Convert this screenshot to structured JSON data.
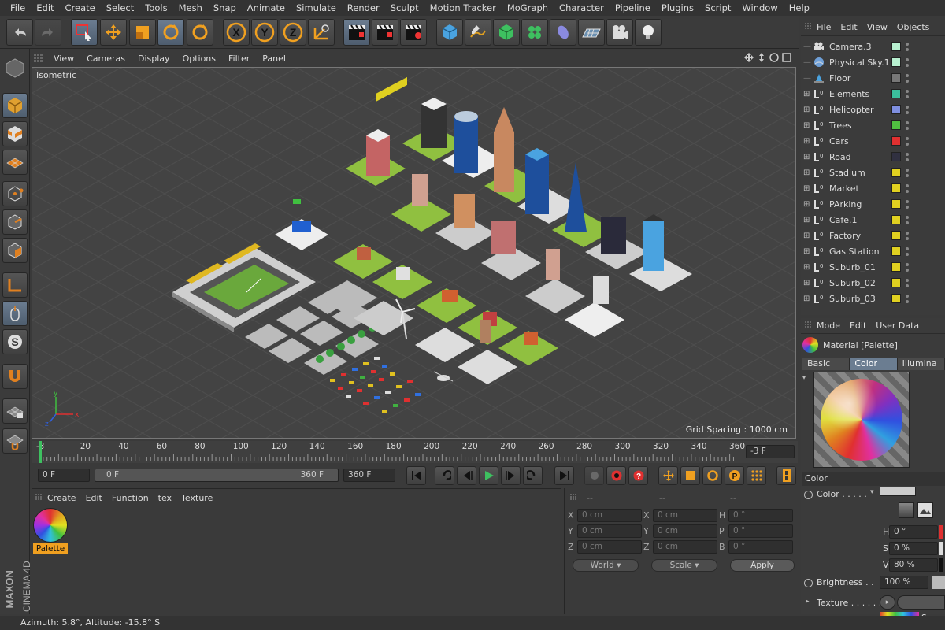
{
  "menubar": [
    "File",
    "Edit",
    "Create",
    "Select",
    "Tools",
    "Mesh",
    "Snap",
    "Animate",
    "Simulate",
    "Render",
    "Sculpt",
    "Motion Tracker",
    "MoGraph",
    "Character",
    "Pipeline",
    "Plugins",
    "Script",
    "Window",
    "Help"
  ],
  "viewport": {
    "menu": [
      "View",
      "Cameras",
      "Display",
      "Options",
      "Filter",
      "Panel"
    ],
    "title": "Isometric",
    "grid_spacing": "Grid Spacing : 1000 cm"
  },
  "timeline": {
    "ticks": [
      "-3",
      "20",
      "40",
      "60",
      "80",
      "100",
      "120",
      "140",
      "160",
      "180",
      "200",
      "220",
      "240",
      "260",
      "280",
      "300",
      "320",
      "340",
      "360"
    ],
    "current_frame": "-3 F"
  },
  "transport": {
    "start": "0 F",
    "slider_left": "0 F",
    "slider_right": "360 F",
    "end": "360 F"
  },
  "material_manager": {
    "menu": [
      "Create",
      "Edit",
      "Function",
      "tex",
      "Texture"
    ],
    "material_name": "Palette"
  },
  "coordinates": {
    "headers": [
      "--",
      "--",
      "--"
    ],
    "rows": [
      {
        "a": "X",
        "av": "0 cm",
        "b": "X",
        "bv": "0 cm",
        "c": "H",
        "cv": "0 °"
      },
      {
        "a": "Y",
        "av": "0 cm",
        "b": "Y",
        "bv": "0 cm",
        "c": "P",
        "cv": "0 °"
      },
      {
        "a": "Z",
        "av": "0 cm",
        "b": "Z",
        "bv": "0 cm",
        "c": "B",
        "cv": "0 °"
      }
    ],
    "world": "World",
    "scale": "Scale",
    "apply": "Apply"
  },
  "object_manager": {
    "menu": [
      "File",
      "Edit",
      "View",
      "Objects"
    ],
    "objects": [
      {
        "name": "Camera.3",
        "color": "#b8f0d0",
        "expand": false,
        "icon": "camera-icon"
      },
      {
        "name": "Physical Sky.1",
        "color": "#b8f0d0",
        "expand": false,
        "icon": "sky-icon"
      },
      {
        "name": "Floor",
        "color": "#777777",
        "expand": false,
        "icon": "floor-icon"
      },
      {
        "name": "Elements",
        "color": "#3bbf9c",
        "expand": true,
        "icon": "null-icon"
      },
      {
        "name": "Helicopter",
        "color": "#7f8fe0",
        "expand": true,
        "icon": "null-icon"
      },
      {
        "name": "Trees",
        "color": "#50c040",
        "expand": true,
        "icon": "null-icon"
      },
      {
        "name": "Cars",
        "color": "#e03030",
        "expand": true,
        "icon": "null-icon"
      },
      {
        "name": "Road",
        "color": "#303040",
        "expand": true,
        "icon": "null-icon"
      },
      {
        "name": "Stadium",
        "color": "#e0d020",
        "expand": true,
        "icon": "null-icon"
      },
      {
        "name": "Market",
        "color": "#e0d020",
        "expand": true,
        "icon": "null-icon"
      },
      {
        "name": "PArking",
        "color": "#e0d020",
        "expand": true,
        "icon": "null-icon"
      },
      {
        "name": "Cafe.1",
        "color": "#e0d020",
        "expand": true,
        "icon": "null-icon"
      },
      {
        "name": "Factory",
        "color": "#e0d020",
        "expand": true,
        "icon": "null-icon"
      },
      {
        "name": "Gas Station",
        "color": "#e0d020",
        "expand": true,
        "icon": "null-icon"
      },
      {
        "name": "Suburb_01",
        "color": "#e0d020",
        "expand": true,
        "icon": "null-icon"
      },
      {
        "name": "Suburb_02",
        "color": "#e0d020",
        "expand": true,
        "icon": "null-icon"
      },
      {
        "name": "Suburb_03",
        "color": "#e0d020",
        "expand": true,
        "icon": "null-icon"
      }
    ]
  },
  "attributes": {
    "menu": [
      "Mode",
      "Edit",
      "User Data"
    ],
    "material_title": "Material [Palette]",
    "tabs": [
      "Basic",
      "Color",
      "Illumina"
    ],
    "active_tab": "Color",
    "section": "Color",
    "color_label": "Color . . . . .",
    "h_label": "H",
    "h_value": "0 °",
    "s_label": "S",
    "s_value": "0 %",
    "v_label": "V",
    "v_value": "80 %",
    "brightness_label": "Brightness . .",
    "brightness_value": "100 %",
    "texture_label": "Texture . . . . . .",
    "sampling": "Sampl"
  },
  "status": "Azimuth: 5.8°, Altitude: -15.8°  S",
  "brand": {
    "maxon": "MAXON",
    "c4d": "CINEMA 4D"
  },
  "colors": {
    "accent": "#6b7d91",
    "selected": "#f0a020"
  }
}
